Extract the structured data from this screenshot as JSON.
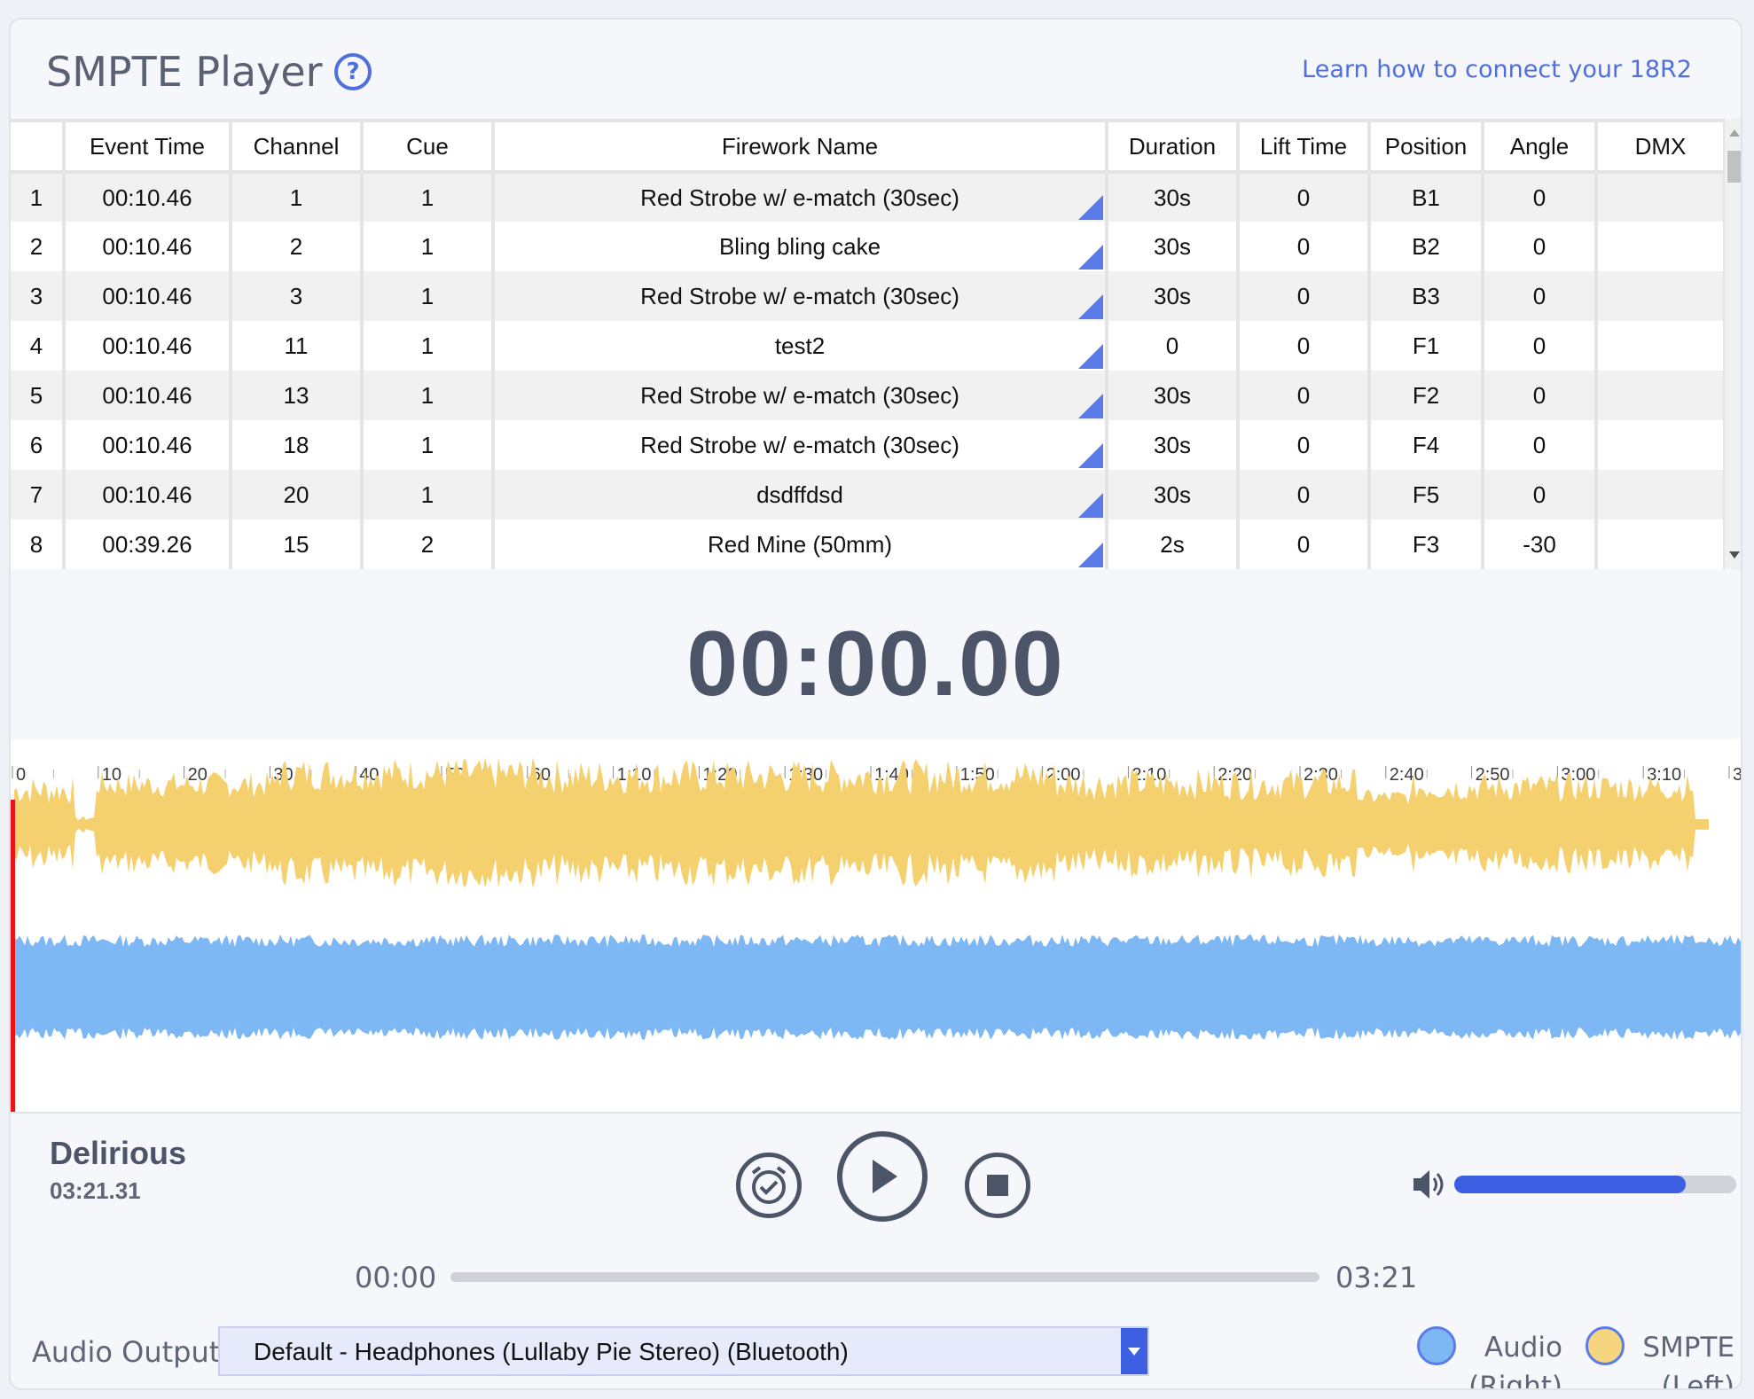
{
  "header": {
    "title": "SMPTE Player",
    "help_icon": "?",
    "learn_link": "Learn how to connect your 18R2"
  },
  "table": {
    "columns": [
      "",
      "Event Time",
      "Channel",
      "Cue",
      "Firework Name",
      "Duration",
      "Lift Time",
      "Position",
      "Angle",
      "DMX"
    ],
    "rows": [
      [
        "1",
        "00:10.46",
        "1",
        "1",
        "Red Strobe w/ e-match (30sec)",
        "30s",
        "0",
        "B1",
        "0",
        ""
      ],
      [
        "2",
        "00:10.46",
        "2",
        "1",
        "Bling bling cake",
        "30s",
        "0",
        "B2",
        "0",
        ""
      ],
      [
        "3",
        "00:10.46",
        "3",
        "1",
        "Red Strobe w/ e-match (30sec)",
        "30s",
        "0",
        "B3",
        "0",
        ""
      ],
      [
        "4",
        "00:10.46",
        "11",
        "1",
        "test2",
        "0",
        "0",
        "F1",
        "0",
        ""
      ],
      [
        "5",
        "00:10.46",
        "13",
        "1",
        "Red Strobe w/ e-match (30sec)",
        "30s",
        "0",
        "F2",
        "0",
        ""
      ],
      [
        "6",
        "00:10.46",
        "18",
        "1",
        "Red Strobe w/ e-match (30sec)",
        "30s",
        "0",
        "F4",
        "0",
        ""
      ],
      [
        "7",
        "00:10.46",
        "20",
        "1",
        "dsdffdsd",
        "30s",
        "0",
        "F5",
        "0",
        ""
      ],
      [
        "8",
        "00:39.26",
        "15",
        "2",
        "Red Mine (50mm)",
        "2s",
        "0",
        "F3",
        "-30",
        ""
      ]
    ]
  },
  "clock": "00:00.00",
  "timeline": {
    "ticks": [
      "0",
      "10",
      "20",
      "30",
      "40",
      "50",
      "60",
      "1:10",
      "1:20",
      "1:30",
      "1:40",
      "1:50",
      "2:00",
      "2:10",
      "2:20",
      "2:30",
      "2:40",
      "2:50",
      "3:00",
      "3:10",
      "3"
    ],
    "smpte_color": "#f5d06e",
    "audio_color": "#7db8f5",
    "playhead_color": "#e8141a"
  },
  "player": {
    "song_title": "Delirious",
    "song_duration": "03:21.31",
    "time_current": "00:00",
    "time_total": "03:21",
    "volume_level": 0.82,
    "icons": {
      "cue": "alarm-clock-icon",
      "play": "play-icon",
      "stop": "stop-icon",
      "volume": "speaker-icon"
    }
  },
  "audio_output": {
    "label": "Audio Output",
    "selected": "Default - Headphones (Lullaby Pie Stereo) (Bluetooth)"
  },
  "legend": {
    "audio_label": "Audio",
    "audio_sub": "(Right)",
    "smpte_label": "SMPTE",
    "smpte_sub": "(Left)",
    "accent": "#3b5fe0"
  }
}
